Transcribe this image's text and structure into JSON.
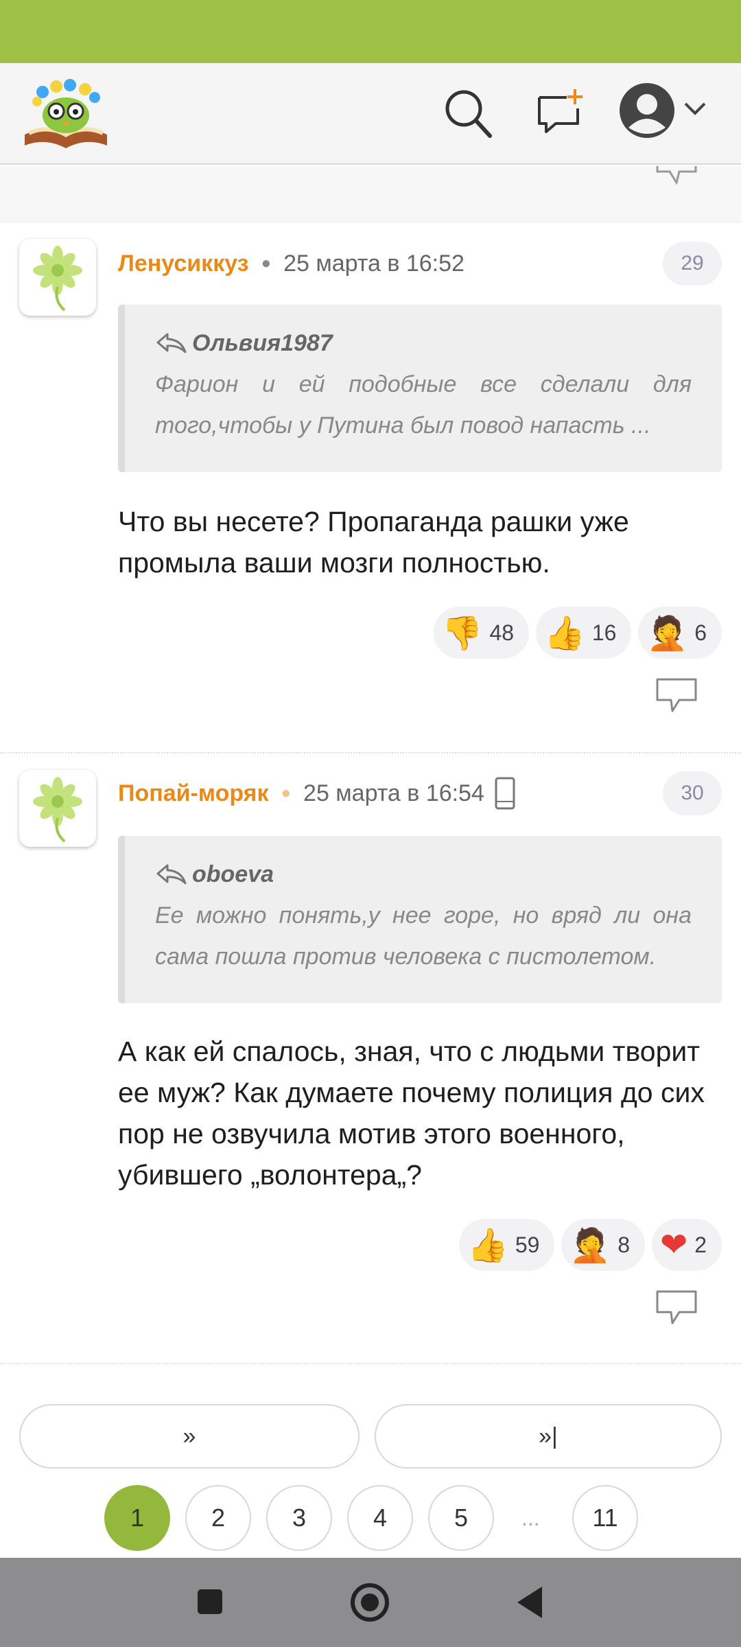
{
  "header": {
    "logo": "book-owl-logo",
    "icons": [
      "search-icon",
      "new-post-icon",
      "avatar-icon",
      "chevron-down-icon"
    ]
  },
  "comments": [
    {
      "author": "Ленусиккуз",
      "date": "25 марта в 16:52",
      "number": "29",
      "quote_author": "Ольвия1987",
      "quote_text": "Фарион и ей подобные все сделали для того,чтобы у Путина был повод напасть ...",
      "text": "Что вы несете? Пропаганда рашки уже промыла ваши мозги полностью.",
      "reactions": [
        {
          "emoji": "👎",
          "count": "48"
        },
        {
          "emoji": "👍",
          "count": "16"
        },
        {
          "emoji": "🤦",
          "count": "6"
        }
      ]
    },
    {
      "author": "Попай-моряк",
      "date": "25 марта в 16:54",
      "number": "30",
      "device": "phone-icon",
      "quote_author": "oboeva",
      "quote_text": "Ее можно понять,у нее горе, но вряд ли она сама пошла против человека с пистолетом.",
      "text": "А как ей спалось, зная, что с людьми творит ее муж? Как думаете почему полиция до сих пор не озвучила мотив этого военного, убившего „волонтера„?",
      "reactions": [
        {
          "emoji": "👍",
          "count": "59"
        },
        {
          "emoji": "🤦",
          "count": "8"
        },
        {
          "emoji": "❤",
          "count": "2"
        }
      ]
    }
  ],
  "pagination": {
    "next_label": "»",
    "last_label": "»|",
    "pages": [
      "1",
      "2",
      "3",
      "4",
      "5",
      "11"
    ],
    "ellipsis": "...",
    "current": "1"
  },
  "colors": {
    "brand_green": "#9ec044",
    "author_orange": "#ea8a16",
    "active_page": "#93b83b"
  }
}
